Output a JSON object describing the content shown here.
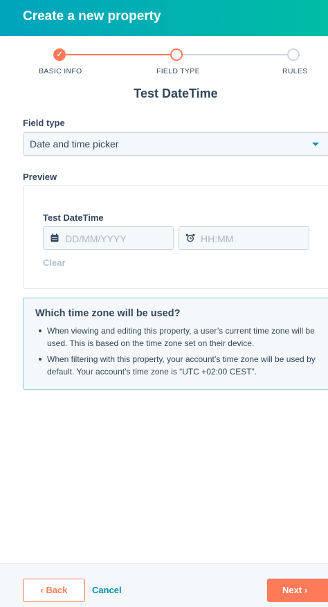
{
  "header": {
    "title": "Create a new property"
  },
  "stepper": {
    "steps": [
      {
        "label": "BASIC INFO",
        "state": "done",
        "icon": "check-icon"
      },
      {
        "label": "FIELD TYPE",
        "state": "active"
      },
      {
        "label": "RULES",
        "state": "todo"
      }
    ],
    "accent_color": "#ff7a59",
    "inactive_color": "#cbd6e2"
  },
  "property_name": "Test DateTime",
  "field_type": {
    "label": "Field type",
    "selected": "Date and time picker",
    "icon": "caret-down-icon"
  },
  "preview": {
    "label": "Preview",
    "field_label": "Test DateTime",
    "date_input": {
      "placeholder": "DD/MM/YYYY",
      "icon": "calendar-icon"
    },
    "time_input": {
      "placeholder": "HH:MM",
      "icon": "alarm-clock-icon"
    },
    "clear_label": "Clear"
  },
  "info": {
    "title": "Which time zone will be used?",
    "bullets": [
      "When viewing and editing this property, a user’s current time zone will be used. This is based on the time zone set on their device.",
      "When filtering with this property, your account’s time zone will be used by default. Your account’s time zone is “UTC +02:00 CEST”."
    ]
  },
  "footer": {
    "back_label": "Back",
    "cancel_label": "Cancel",
    "next_label": "Next"
  },
  "colors": {
    "header_gradient_start": "#00a4bd",
    "header_gradient_end": "#00bda5",
    "primary_button": "#ff7a59",
    "link": "#0091ae"
  }
}
